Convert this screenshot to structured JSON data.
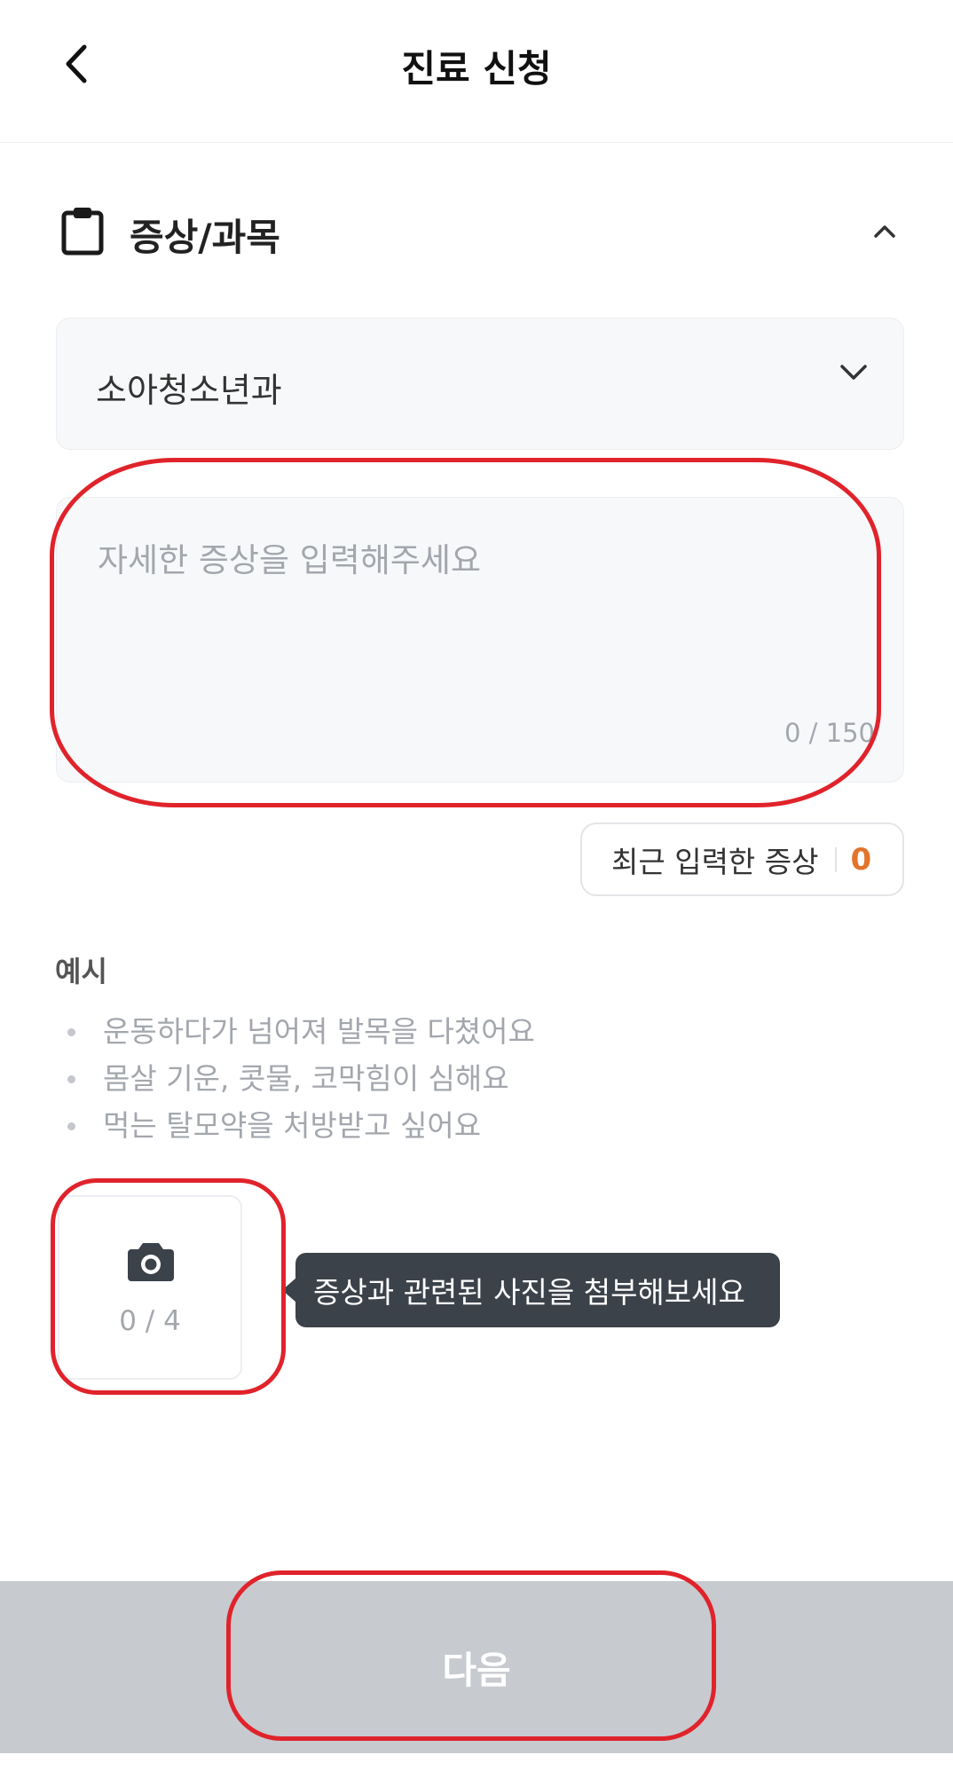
{
  "header": {
    "title": "진료 신청",
    "back_icon": "chevron-left-icon"
  },
  "section": {
    "icon": "clipboard-icon",
    "title": "증상/과목",
    "collapse_icon": "chevron-up-icon"
  },
  "department_select": {
    "value": "소아청소년과",
    "icon": "chevron-down-icon"
  },
  "symptom_input": {
    "value": "",
    "placeholder": "자세한 증상을 입력해주세요",
    "char_count": "0 / 150"
  },
  "recent_symptoms": {
    "label": "최근 입력한 증상",
    "count": "0"
  },
  "examples": {
    "title": "예시",
    "items": [
      "운동하다가 넘어져 발목을 다쳤어요",
      "몸살 기운, 콧물, 코막힘이 심해요",
      "먹는 탈모약을 처방받고 싶어요"
    ]
  },
  "photo_upload": {
    "icon": "camera-icon",
    "count": "0 / 4",
    "tooltip": "증상과 관련된 사진을 첨부해보세요"
  },
  "footer": {
    "next_label": "다음"
  },
  "colors": {
    "accent_orange": "#e2742b",
    "input_bg": "#f7f8fa",
    "disabled_button": "#c7cacf",
    "tooltip_bg": "#3c424a",
    "annotation_red": "#e0232b"
  }
}
